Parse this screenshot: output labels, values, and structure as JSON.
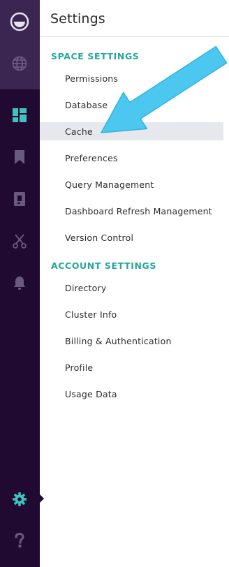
{
  "nav": {
    "items": [
      {
        "name": "logo",
        "icon": "logo-icon"
      },
      {
        "name": "globe",
        "icon": "globe-icon"
      },
      {
        "name": "dashboards",
        "icon": "dashboard-grid-icon",
        "active": true
      },
      {
        "name": "bookmarks",
        "icon": "bookmark-icon"
      },
      {
        "name": "notebook",
        "icon": "notebook-icon"
      },
      {
        "name": "tools",
        "icon": "scissors-icon"
      },
      {
        "name": "alerts",
        "icon": "bell-icon"
      },
      {
        "name": "settings",
        "icon": "gear-icon",
        "active": true
      },
      {
        "name": "help",
        "icon": "question-icon"
      }
    ]
  },
  "panel": {
    "title": "Settings",
    "sections": [
      {
        "heading": "SPACE SETTINGS",
        "items": [
          "Permissions",
          "Database",
          "Cache",
          "Preferences",
          "Query Management",
          "Dashboard Refresh Management",
          "Version Control"
        ]
      },
      {
        "heading": "ACCOUNT SETTINGS",
        "items": [
          "Directory",
          "Cluster Info",
          "Billing & Authentication",
          "Profile",
          "Usage Data"
        ]
      }
    ],
    "active_item": "Cache"
  },
  "colors": {
    "rail_bg": "#200a32",
    "rail_top_bg": "#3a2650",
    "accent_teal": "#23a89a",
    "icon_active": "#3fc3c0",
    "icon_muted": "#6b5a80",
    "highlight_arrow": "#4cc8f0",
    "active_row": "#e6e8ee"
  }
}
